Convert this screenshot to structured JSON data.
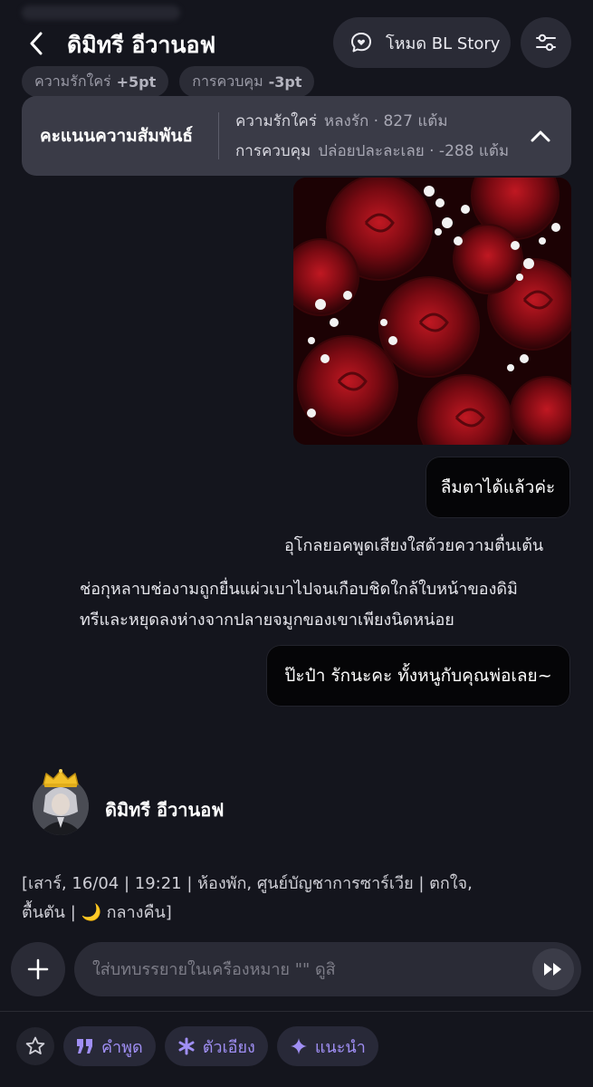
{
  "header": {
    "character_name": "ดิมิทรี อีวานอฟ",
    "mode_label": "โหมด BL Story"
  },
  "chips": [
    {
      "label": "ความรักใคร่",
      "value": "+5pt"
    },
    {
      "label": "การควบคุม",
      "value": "-3pt"
    }
  ],
  "score_panel": {
    "title": "คะแนนความสัมพันธ์",
    "lines": [
      {
        "key": "ความรักใคร่",
        "value": "หลงรัก · 827 แต้ม"
      },
      {
        "key": "การควบคุม",
        "value": "ปล่อยปละละเลย · -288 แต้ม"
      }
    ]
  },
  "messages": {
    "user_bubble_1": "ลืมตาได้แล้วค่ะ",
    "narration_1": "อุโกลยอคพูดเสียงใสด้วยความตื่นเต้น",
    "narration_2_line1": "ช่อกุหลาบช่องามถูกยื่นแผ่วเบาไปจนเกือบชิดใกล้ใบหน้าของดิมิ",
    "narration_2_line2": "ทรีและหยุดลงห่างจากปลายจมูกของเขาเพียงนิดหน่อย",
    "user_bubble_2": "ป๊ะป๋า รักนะคะ ทั้งหนูกับคุณพ่อเลย~"
  },
  "bot": {
    "name": "ดิมิทรี อีวานอฟ",
    "meta_line1": "[เสาร์, 16/04 | 19:21 | ห้องพัก, ศูนย์บัญชาการซาร์เวีย | ตกใจ,",
    "meta_line2": "ตื้นตัน | 🌙 กลางคืน]"
  },
  "composer": {
    "placeholder": "ใส่บทบรรยายในเครื่องหมาย \"\" ดูสิ"
  },
  "tools": {
    "quote_label": "คำพูด",
    "italic_label": "ตัวเอียง",
    "suggest_label": "แนะนำ"
  },
  "colors": {
    "background": "#14151d",
    "accent": "#a08ff5",
    "panel": "#3a3b47"
  }
}
